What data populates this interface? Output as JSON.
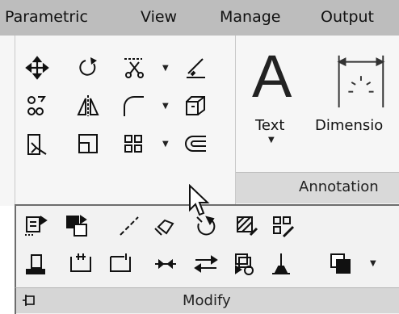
{
  "ribbon": {
    "tabs": [
      "Parametric",
      "View",
      "Manage",
      "Output"
    ]
  },
  "annotation_panel": {
    "text_label": "Text",
    "dimension_label": "Dimensio",
    "panel_title": "Annotation"
  },
  "modify_panel": {
    "panel_title": "Modify"
  },
  "icons": {
    "row1": [
      "move-icon",
      "rotate-icon",
      "trim-extend-icon",
      "offset-icon"
    ],
    "row2": [
      "copy-icon",
      "mirror-icon",
      "fillet-icon",
      "array-3d-icon"
    ],
    "row3": [
      "align-icon",
      "scale-icon",
      "array-icon",
      "join-icon"
    ],
    "flyout_row1": [
      "stretch-icon",
      "copy-properties-icon",
      "line-icon",
      "explode-icon",
      "reverse-icon",
      "edit-hatch-icon",
      "edit-array-icon"
    ],
    "flyout_row2": [
      "align-bottom-icon",
      "break-icon",
      "break-at-point-icon",
      "join-line-icon",
      "swap-icon",
      "overkill-icon",
      "set-base-icon",
      "draw-order-icon"
    ]
  }
}
